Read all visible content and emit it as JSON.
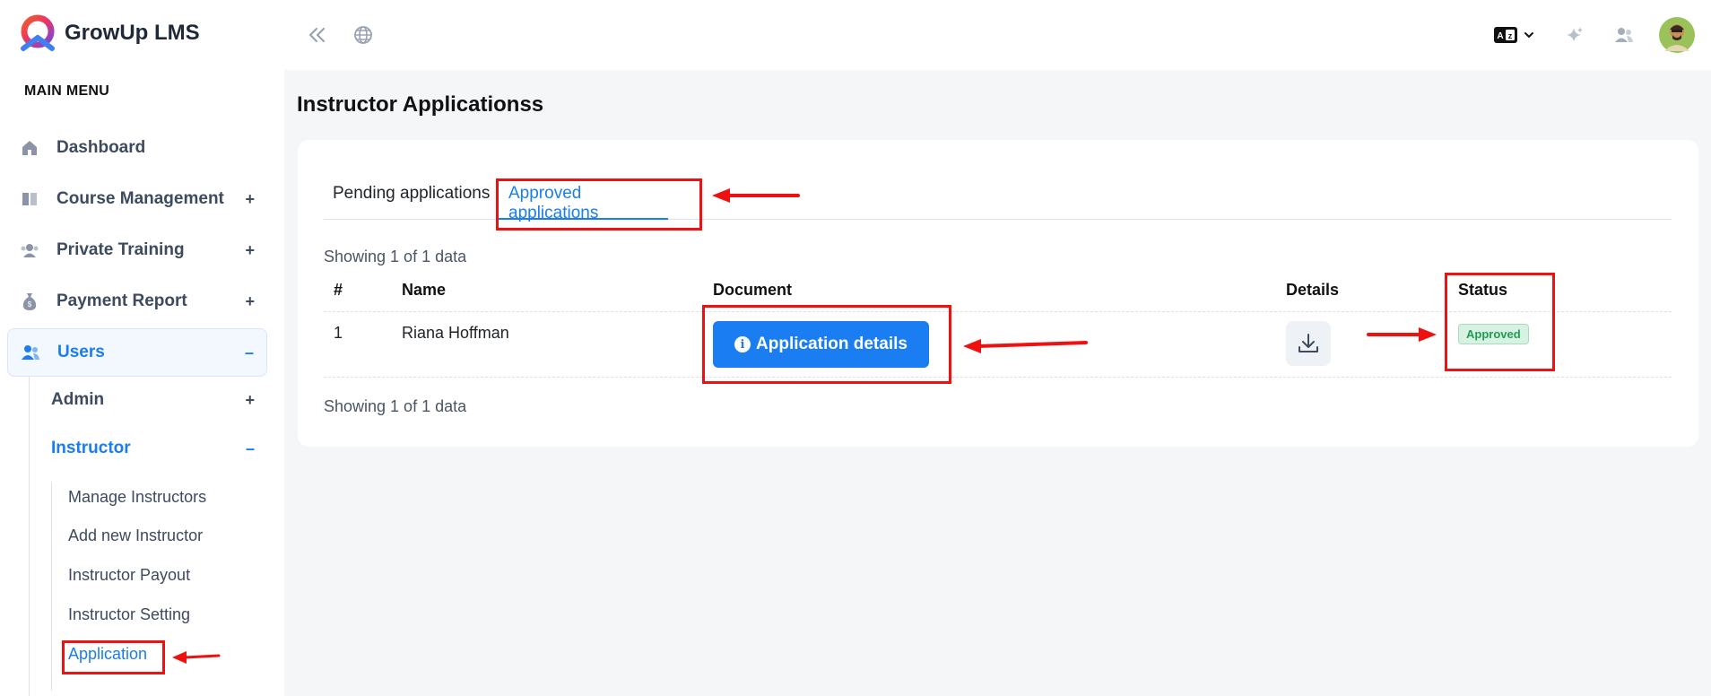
{
  "app": {
    "name": "GrowUp LMS",
    "menu_title": "MAIN MENU"
  },
  "sidebar": {
    "items": [
      {
        "label": "Dashboard",
        "icon": "home-icon",
        "toggle": ""
      },
      {
        "label": "Course Management",
        "icon": "book-icon",
        "toggle": "+"
      },
      {
        "label": "Private Training",
        "icon": "group-icon",
        "toggle": "+"
      },
      {
        "label": "Payment Report",
        "icon": "money-bag-icon",
        "toggle": "+"
      },
      {
        "label": "Users",
        "icon": "users-icon",
        "toggle": "–"
      }
    ],
    "users_sub": [
      {
        "label": "Admin",
        "toggle": "+"
      },
      {
        "label": "Instructor",
        "toggle": "–"
      }
    ],
    "instructor_sub": [
      {
        "label": "Manage Instructors"
      },
      {
        "label": "Add new Instructor"
      },
      {
        "label": "Instructor Payout"
      },
      {
        "label": "Instructor Setting"
      },
      {
        "label": "Application"
      }
    ]
  },
  "page": {
    "title": "Instructor Applicationss"
  },
  "tabs": [
    {
      "label": "Pending applications"
    },
    {
      "label": "Approved applications"
    }
  ],
  "table": {
    "showing_top": "Showing 1 of 1 data",
    "showing_bottom": "Showing 1 of 1 data",
    "headers": {
      "num": "#",
      "name": "Name",
      "document": "Document",
      "details": "Details",
      "status": "Status"
    },
    "rows": [
      {
        "num": "1",
        "name": "Riana Hoffman",
        "document_button": "Application details",
        "status": "Approved"
      }
    ]
  },
  "colors": {
    "accent": "#1a7df1",
    "annotation": "#ee1111",
    "approved_badge": "#1f9d55"
  }
}
